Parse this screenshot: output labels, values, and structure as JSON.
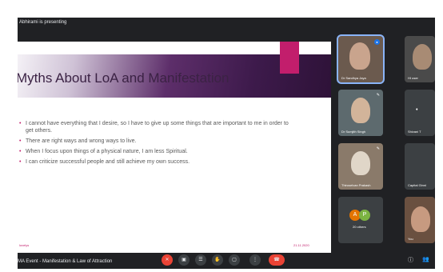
{
  "header": {
    "presenting_text": "Abhirami is presenting"
  },
  "slide": {
    "title": "Myths About LoA and Manifestation",
    "bullets": [
      "I cannot have everything that I desire, so I have to give up some things that are important to me in order to get others.",
      "There are right ways and wrong ways to live.",
      "When I focus upon things of a physical nature, I am less Spiritual.",
      "I can criticize successful people and still achieve my own success."
    ],
    "footer_left": "lovelys",
    "footer_right": "21.11.2020",
    "colors": {
      "accent": "#c21e6c",
      "banner_dark": "#3d1a4b"
    }
  },
  "participants": [
    {
      "name": "Dr Sandhya Jaya",
      "speaking": true
    },
    {
      "name": "HI user"
    },
    {
      "name": "Dr Sumjith Singh"
    },
    {
      "name": "Shivani T"
    },
    {
      "name": "Thiruselvan Prakash"
    },
    {
      "name": "Capital Ginni"
    },
    {
      "name": "20 others",
      "avatar_icons": [
        "A",
        "P"
      ]
    },
    {
      "name": "You"
    }
  ],
  "bottom_bar": {
    "meeting_title": "MA Event - Manifestation & Law of Attraction",
    "controls": [
      {
        "name": "mic-off-icon",
        "glyph": "✕"
      },
      {
        "name": "camera-icon",
        "glyph": "▣"
      },
      {
        "name": "captions-icon",
        "glyph": "☰"
      },
      {
        "name": "raise-hand-icon",
        "glyph": "✋"
      },
      {
        "name": "present-icon",
        "glyph": "▢"
      },
      {
        "name": "more-options-icon",
        "glyph": "⋮"
      }
    ],
    "end_call_glyph": "☎",
    "right_icons": [
      {
        "name": "info-icon",
        "glyph": "ⓘ"
      },
      {
        "name": "people-icon",
        "glyph": "👥"
      }
    ]
  }
}
